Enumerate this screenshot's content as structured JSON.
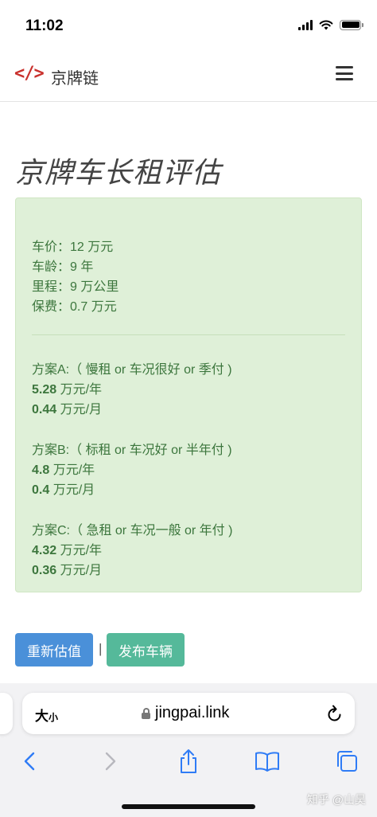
{
  "status": {
    "time": "11:02"
  },
  "navbar": {
    "brand_icon": "</>",
    "brand": "京牌链"
  },
  "page": {
    "title": "京牌车长租评估"
  },
  "panel": {
    "specs": [
      "车价：12 万元",
      "车龄：9 年",
      "里程：9 万公里",
      "保费：0.7 万元"
    ],
    "plans": [
      {
        "label": "方案A:（ 慢租 or 车况很好 or 季付 )",
        "yearly_value": "5.28",
        "yearly_unit": " 万元/年",
        "monthly_value": "0.44",
        "monthly_unit": " 万元/月"
      },
      {
        "label": "方案B:（ 标租 or 车况好 or 半年付 )",
        "yearly_value": "4.8",
        "yearly_unit": " 万元/年",
        "monthly_value": "0.4",
        "monthly_unit": " 万元/月"
      },
      {
        "label": "方案C:（ 急租 or 车况一般 or 年付 )",
        "yearly_value": "4.32",
        "yearly_unit": " 万元/年",
        "monthly_value": "0.36",
        "monthly_unit": " 万元/月"
      }
    ]
  },
  "buttons": {
    "reestimate": "重新估值",
    "separator": "|",
    "publish": "发布车辆"
  },
  "browser": {
    "text_size": "大",
    "text_size_small": "小",
    "url": "jingpai.link",
    "watermark": "知乎 @山昊"
  },
  "colors": {
    "panel_bg": "#dff0d8",
    "panel_text": "#3c763d",
    "primary": "#4a90d9",
    "success": "#55b99a",
    "brand_icon": "#c9302c"
  },
  "icons": [
    "code-icon",
    "hamburger-menu-icon",
    "lock-icon",
    "reload-icon",
    "back-icon",
    "forward-icon",
    "share-icon",
    "bookmarks-icon",
    "tabs-icon"
  ]
}
